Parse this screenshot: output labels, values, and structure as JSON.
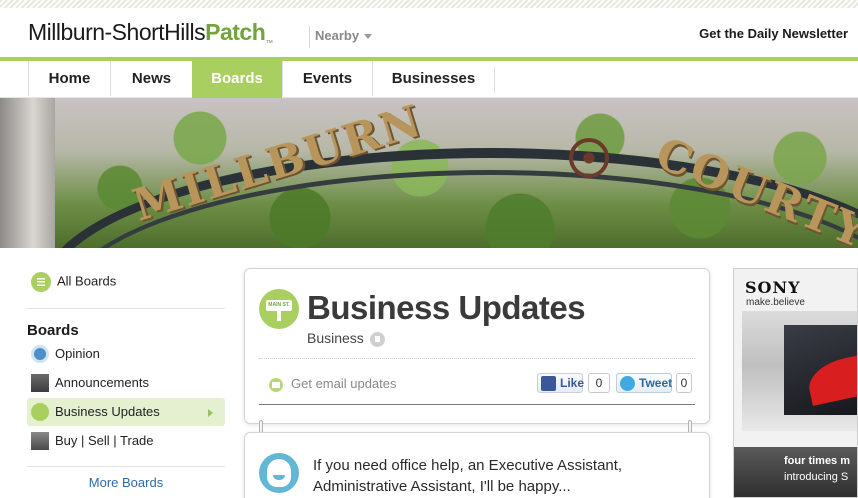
{
  "header": {
    "site_name_part1": "Millburn-ShortHills",
    "site_name_brand": "Patch",
    "nearby_label": "Nearby",
    "newsletter_link": "Get the Daily Newsletter"
  },
  "nav": {
    "tabs": [
      {
        "label": "Home"
      },
      {
        "label": "News"
      },
      {
        "label": "Boards",
        "active": true
      },
      {
        "label": "Events"
      },
      {
        "label": "Businesses"
      }
    ]
  },
  "hero": {
    "arch_text_1": "MILLBURN",
    "arch_text_2": "COURTY"
  },
  "sidebar": {
    "all_boards": "All Boards",
    "heading": "Boards",
    "items": [
      {
        "label": "Opinion",
        "icon": "opinion-icon"
      },
      {
        "label": "Announcements",
        "icon": "announcements-thumb"
      },
      {
        "label": "Business Updates",
        "icon": "business-updates-icon",
        "active": true
      },
      {
        "label": "Buy | Sell | Trade",
        "icon": "buy-sell-trade-thumb"
      }
    ],
    "more_boards": "More Boards"
  },
  "board": {
    "icon_text": "MAIN ST.",
    "title": "Business Updates",
    "category": "Business",
    "email_updates": "Get email updates",
    "like_label": "Like",
    "like_count": "0",
    "tweet_label": "Tweet",
    "tweet_count": "0"
  },
  "post": {
    "text": "If you need office help, an Executive Assistant, Administrative Assistant, I'll be happy..."
  },
  "ad": {
    "brand": "SONY",
    "tagline": "make.believe",
    "line1": "four times m",
    "line2": "introducing S"
  },
  "colors": {
    "accent_green": "#a8cf5f",
    "brand_green": "#73a43a",
    "link_blue": "#2f6aa6"
  }
}
